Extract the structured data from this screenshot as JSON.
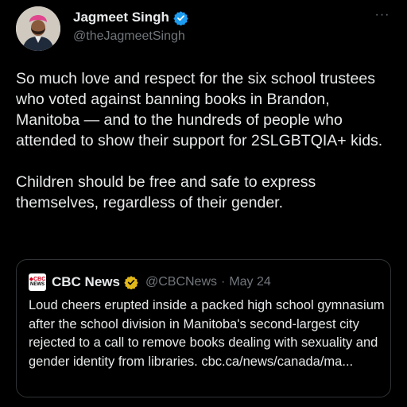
{
  "tweet": {
    "author": {
      "display_name": "Jagmeet Singh",
      "handle": "@theJagmeetSingh",
      "verified_icon": "verified-badge-blue"
    },
    "more_icon": "more-options-icon",
    "more_glyph": "···",
    "text": "So much love and respect for the six school trustees who voted against banning books in Brandon, Manitoba — and to the hundreds of people who attended to show their support for 2SLGBTQIA+ kids.\n\nChildren should be free and safe to express themselves, regardless of their gender."
  },
  "quote": {
    "logo_top": "◆CBC",
    "logo_bottom": "NEWS",
    "name": "CBC News",
    "verified_icon": "verified-badge-gold",
    "handle": "@CBCNews",
    "separator": "·",
    "date": "May 24",
    "text": "Loud cheers erupted inside a packed high school gymnasium after the school division in Manitoba's second-largest city rejected to a call to remove books dealing with sexuality and gender identity from libraries. cbc.ca/news/canada/ma..."
  },
  "colors": {
    "background": "#000000",
    "primary_text": "#e7e9ea",
    "secondary_text": "#71767b",
    "border": "#2f3336",
    "verified_blue": "#1d9bf0",
    "verified_gold": "#e2b719",
    "cbc_red": "#d6001c"
  }
}
